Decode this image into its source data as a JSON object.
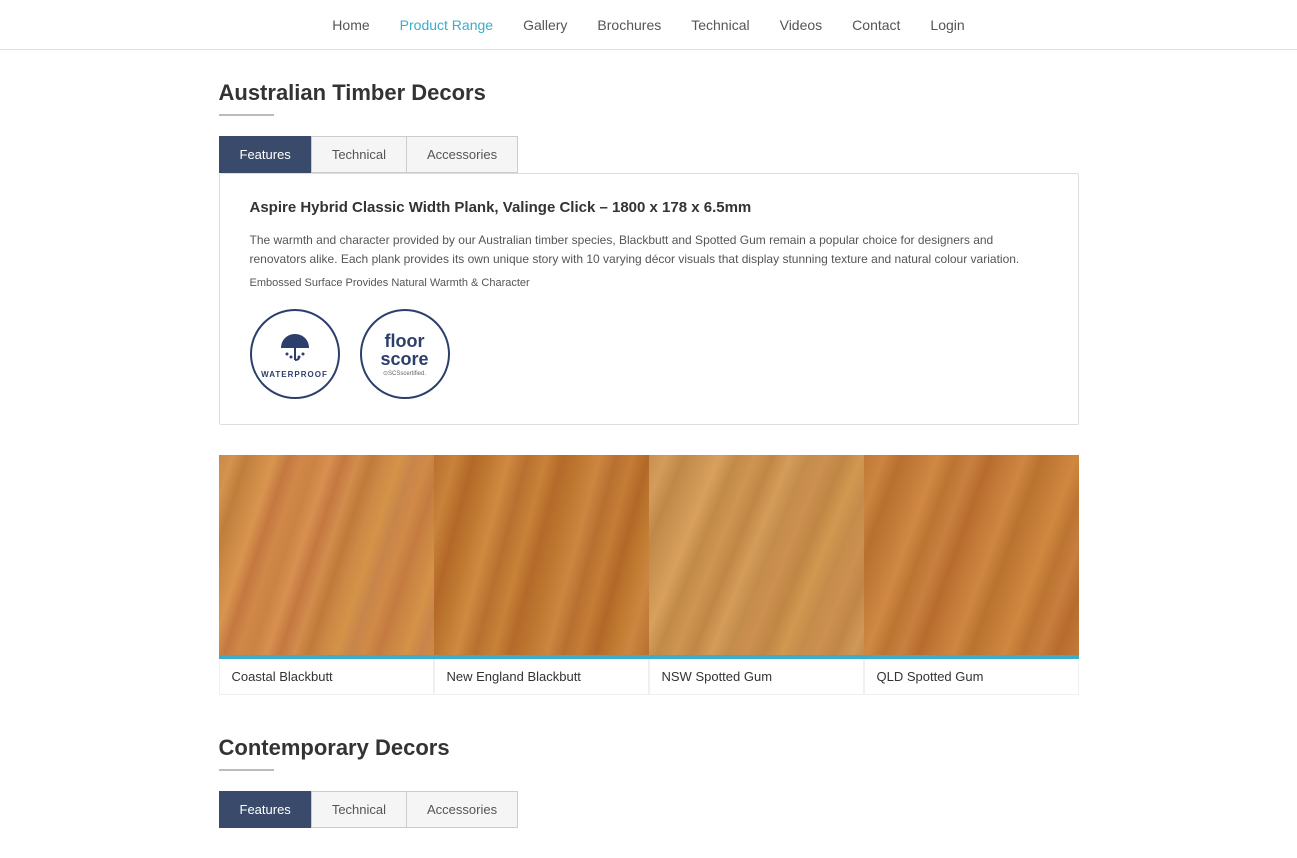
{
  "nav": {
    "items": [
      {
        "label": "Home",
        "active": false
      },
      {
        "label": "Product Range",
        "active": true
      },
      {
        "label": "Gallery",
        "active": false
      },
      {
        "label": "Brochures",
        "active": false
      },
      {
        "label": "Technical",
        "active": false
      },
      {
        "label": "Videos",
        "active": false
      },
      {
        "label": "Contact",
        "active": false
      },
      {
        "label": "Login",
        "active": false
      }
    ]
  },
  "section1": {
    "title": "Australian Timber Decors",
    "tabs": [
      {
        "label": "Features",
        "active": true
      },
      {
        "label": "Technical",
        "active": false
      },
      {
        "label": "Accessories",
        "active": false
      }
    ],
    "infobox": {
      "title": "Aspire Hybrid Classic Width Plank, Valinge Click – 1800 x 178 x 6.5mm",
      "description": "The warmth and character provided by our Australian timber species, Blackbutt and Spotted Gum remain a popular choice for designers and renovators alike. Each plank provides its own unique story with 10 varying décor visuals that display stunning texture and natural colour variation.",
      "subtitle": "Embossed Surface Provides Natural Warmth & Character",
      "badge_waterproof_text": "WATERPROOF",
      "badge_floorscore_line1": "floor",
      "badge_floorscore_line2": "score",
      "badge_floorscore_cert": "SCSscertified."
    },
    "products": [
      {
        "label": "Coastal Blackbutt",
        "wood_class": "wood-coastal"
      },
      {
        "label": "New England Blackbutt",
        "wood_class": "wood-newengland"
      },
      {
        "label": "NSW Spotted Gum",
        "wood_class": "wood-nsw"
      },
      {
        "label": "QLD Spotted Gum",
        "wood_class": "wood-qld"
      }
    ]
  },
  "section2": {
    "title": "Contemporary Decors",
    "tabs": [
      {
        "label": "Features",
        "active": true
      },
      {
        "label": "Technical",
        "active": false
      },
      {
        "label": "Accessories",
        "active": false
      }
    ]
  }
}
